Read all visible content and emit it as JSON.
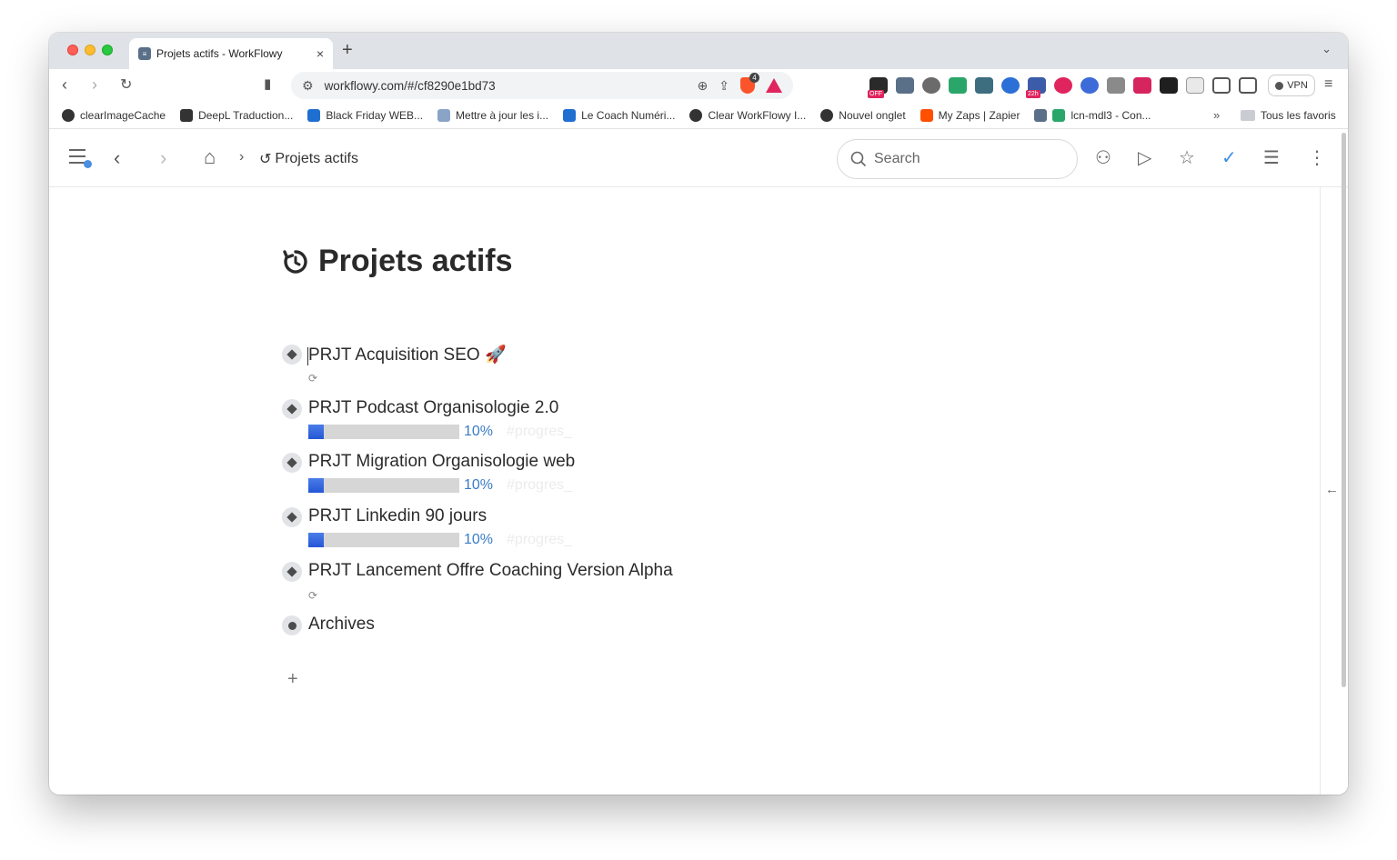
{
  "browser": {
    "tab_title": "Projets actifs - WorkFlowy",
    "tab_close": "×",
    "new_tab": "+",
    "url": "workflowy.com/#/cf8290e1bd73",
    "shield_count": "4",
    "vpn_label": "VPN",
    "ext_badges": {
      "off": "OFF",
      "time": "22h"
    }
  },
  "bookmarks": [
    {
      "label": "clearImageCache"
    },
    {
      "label": "DeepL Traduction..."
    },
    {
      "label": "Black Friday WEB..."
    },
    {
      "label": "Mettre à jour les i..."
    },
    {
      "label": "Le Coach Numéri..."
    },
    {
      "label": "Clear WorkFlowy I..."
    },
    {
      "label": "Nouvel onglet"
    },
    {
      "label": "My Zaps | Zapier"
    },
    {
      "label": "lcn-mdl3 - Con..."
    }
  ],
  "bookmarks_more": "»",
  "bookmarks_all": "Tous les favoris",
  "header": {
    "breadcrumb": "Projets actifs",
    "search_placeholder": "Search"
  },
  "page": {
    "title": "Projets actifs"
  },
  "items": [
    {
      "title": "PRJT Acquisition SEO 🚀",
      "note": "⟳"
    },
    {
      "title": "PRJT Podcast Organisologie 2.0",
      "progress": 0.1,
      "pct": "10%",
      "tag": "#progres_"
    },
    {
      "title": "PRJT Migration Organisologie web",
      "progress": 0.1,
      "pct": "10%",
      "tag": "#progres_"
    },
    {
      "title": "PRJT Linkedin 90 jours",
      "progress": 0.1,
      "pct": "10%",
      "tag": "#progres_"
    },
    {
      "title": "PRJT Lancement Offre Coaching Version Alpha",
      "note": "⟳"
    },
    {
      "title": "Archives"
    }
  ],
  "add_item": "+"
}
